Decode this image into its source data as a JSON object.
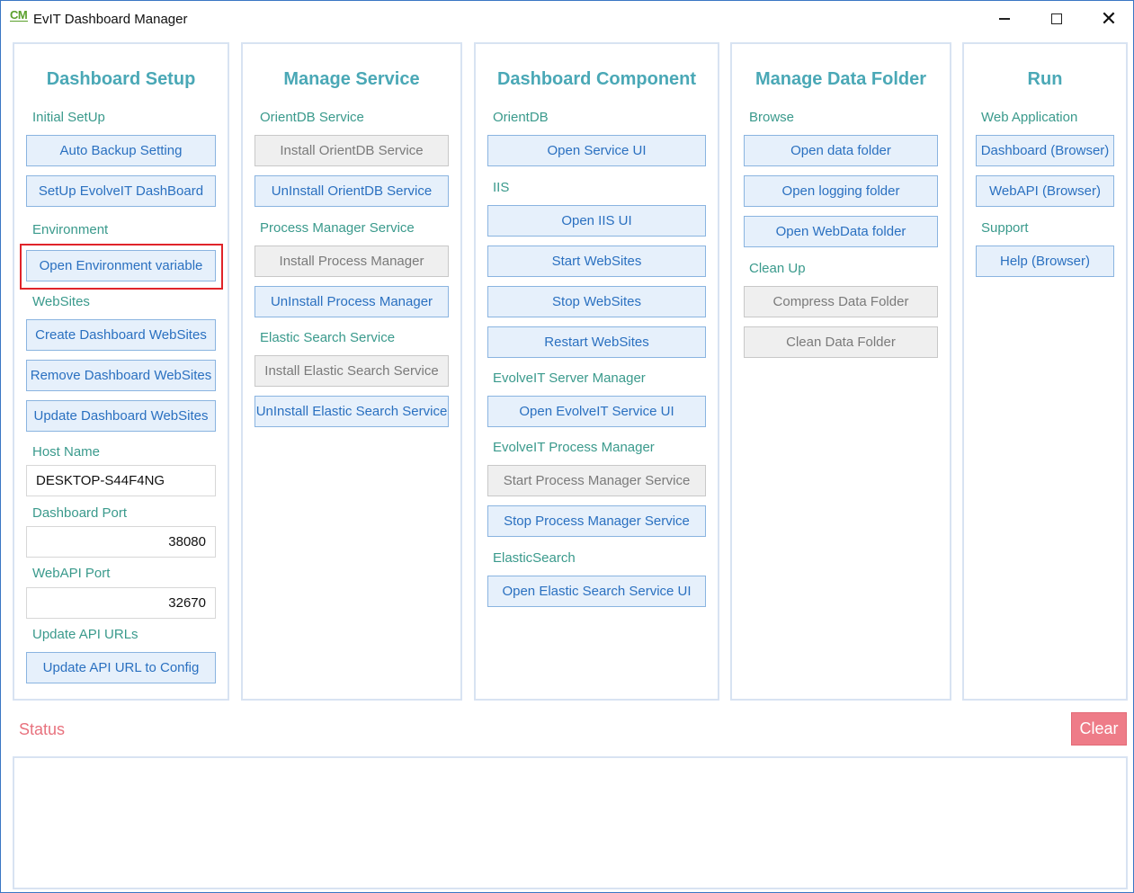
{
  "window": {
    "title": "EvIT Dashboard Manager",
    "logo_text": "CM"
  },
  "panels": {
    "setup": {
      "title": "Dashboard Setup",
      "initial_setup_label": "Initial SetUp",
      "auto_backup": "Auto Backup Setting",
      "setup_dashboard": "SetUp EvolveIT DashBoard",
      "environment_label": "Environment",
      "open_env": "Open Environment variable",
      "websites_label": "WebSites",
      "create_sites": "Create Dashboard WebSites",
      "remove_sites": "Remove Dashboard WebSites",
      "update_sites": "Update Dashboard WebSites",
      "host_name_label": "Host Name",
      "host_name_value": "DESKTOP-S44F4NG",
      "dashboard_port_label": "Dashboard Port",
      "dashboard_port_value": "38080",
      "webapi_port_label": "WebAPI Port",
      "webapi_port_value": "32670",
      "update_api_label": "Update API URLs",
      "update_api": "Update API URL to Config"
    },
    "service": {
      "title": "Manage Service",
      "orientdb_label": "OrientDB Service",
      "install_orientdb": "Install OrientDB Service",
      "uninstall_orientdb": "UnInstall OrientDB Service",
      "process_label": "Process Manager Service",
      "install_process": "Install Process Manager",
      "uninstall_process": "UnInstall Process Manager",
      "elastic_label": "Elastic Search Service",
      "install_elastic": "Install Elastic Search Service",
      "uninstall_elastic": "UnInstall Elastic Search Service"
    },
    "component": {
      "title": "Dashboard Component",
      "orientdb_label": "OrientDB",
      "open_service_ui": "Open Service UI",
      "iis_label": "IIS",
      "open_iis": "Open IIS UI",
      "start_sites": "Start WebSites",
      "stop_sites": "Stop WebSites",
      "restart_sites": "Restart WebSites",
      "server_mgr_label": "EvolveIT Server Manager",
      "open_evolveit_ui": "Open EvolveIT Service UI",
      "process_mgr_label": "EvolveIT Process Manager",
      "start_process": "Start Process Manager Service",
      "stop_process": "Stop Process Manager Service",
      "elastic_label": "ElasticSearch",
      "open_elastic_ui": "Open Elastic Search Service UI"
    },
    "data": {
      "title": "Manage Data Folder",
      "browse_label": "Browse",
      "open_data": "Open data folder",
      "open_logging": "Open logging folder",
      "open_webdata": "Open WebData folder",
      "cleanup_label": "Clean Up",
      "compress": "Compress Data Folder",
      "clean": "Clean Data Folder"
    },
    "run": {
      "title": "Run",
      "webapp_label": "Web Application",
      "dashboard_browser": "Dashboard (Browser)",
      "webapi_browser": "WebAPI (Browser)",
      "support_label": "Support",
      "help_browser": "Help (Browser)"
    }
  },
  "status": {
    "label": "Status",
    "clear": "Clear",
    "log": ""
  }
}
